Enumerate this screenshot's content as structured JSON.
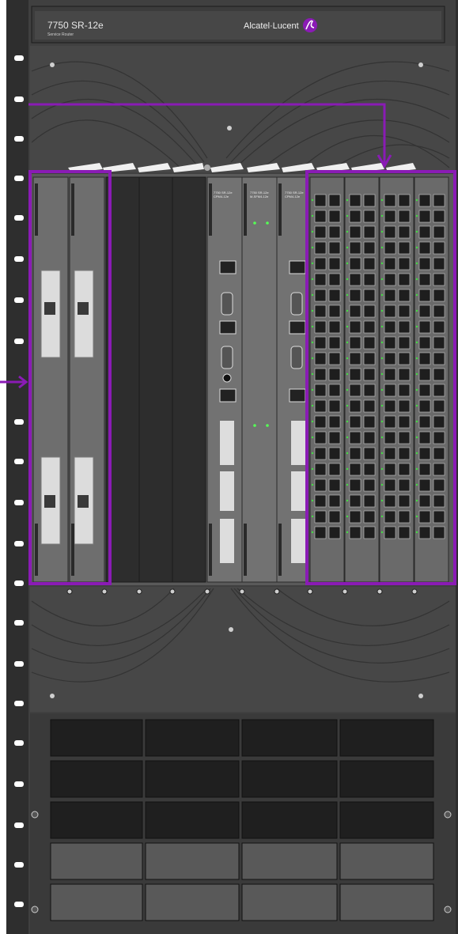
{
  "header": {
    "model": "7750 SR-12e",
    "subtitle": "Service Router",
    "brand": "Alcatel·Lucent",
    "logo_icon": "alcatel-lucent-logo-icon"
  },
  "cards": {
    "cpm_label_a": "7750 SR-12e",
    "cpm_label_b": "CPM4-12e",
    "sfm_label_a": "7750 SR-12e",
    "sfm_label_b": "M-SFM4-12e"
  },
  "colors": {
    "highlight": "#8a1bb5",
    "chassis": "#3a3a3a",
    "panel": "#555555",
    "card": "#6d6d6d",
    "slot_empty": "#2d2d2d"
  },
  "callouts": {
    "left_group": "left-mda-card-group",
    "right_group": "right-port-card-group"
  }
}
